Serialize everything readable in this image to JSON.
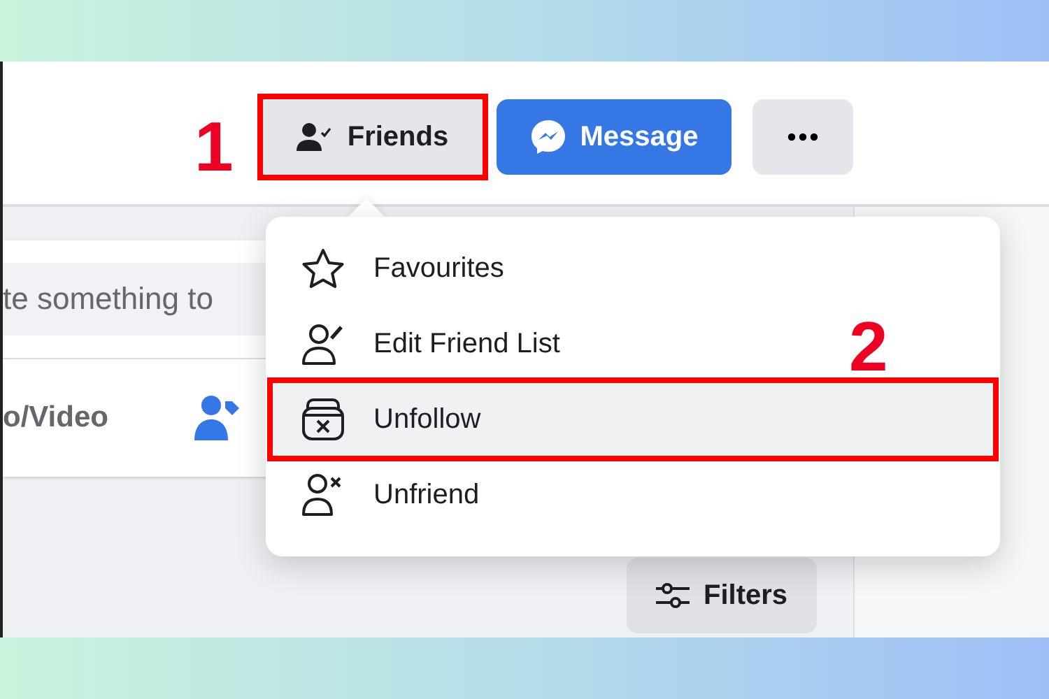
{
  "profile_actions": [
    {
      "kind": "friends",
      "label": "Friends",
      "marked": true
    },
    {
      "kind": "message",
      "label": "Message",
      "marked": false
    },
    {
      "kind": "more",
      "marked": false
    }
  ],
  "composer": {
    "placeholder": "te something to",
    "actions": [
      {
        "kind": "photo",
        "label": "o/Video"
      },
      {
        "kind": "tag"
      }
    ]
  },
  "friends_menu": {
    "items": [
      {
        "kind": "star",
        "label": "Favourites",
        "hovered": false,
        "marked": false
      },
      {
        "kind": "edit",
        "label": "Edit Friend List",
        "hovered": false,
        "marked": false
      },
      {
        "kind": "unfollow",
        "label": "Unfollow",
        "hovered": true,
        "marked": true
      },
      {
        "kind": "unfriend",
        "label": "Unfriend",
        "hovered": false,
        "marked": false
      }
    ]
  },
  "filters_button": {
    "label": "Filters"
  },
  "annotations": [
    {
      "label": "1"
    },
    {
      "label": "2"
    }
  ]
}
